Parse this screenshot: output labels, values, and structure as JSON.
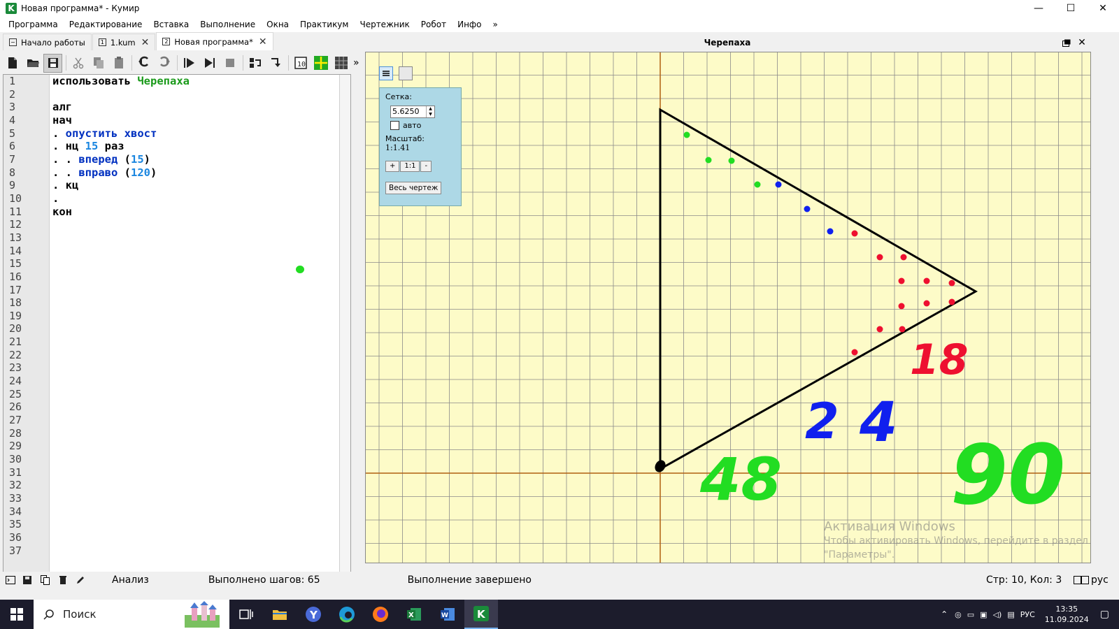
{
  "window": {
    "title": "Новая программа* - Кумир",
    "app_icon_letter": "K",
    "min_label": "—",
    "max_label": "☐",
    "close_label": "✕"
  },
  "menu": [
    "Программа",
    "Редактирование",
    "Вставка",
    "Выполнение",
    "Окна",
    "Практикум",
    "Чертежник",
    "Робот",
    "Инфо",
    "»"
  ],
  "tabs": [
    {
      "label": "Начало работы",
      "icon": "~",
      "close": ""
    },
    {
      "label": "1.kum",
      "icon": "1",
      "close": "✕"
    },
    {
      "label": "Новая программа*",
      "icon": "2",
      "close": "✕"
    }
  ],
  "toolbar_overflow": "»",
  "editor": {
    "line_count": 37,
    "lines": [
      [
        {
          "t": "использовать ",
          "c": "kw"
        },
        {
          "t": "Черепаха",
          "c": "green"
        }
      ],
      [],
      [
        {
          "t": "алг",
          "c": "kw"
        }
      ],
      [
        {
          "t": "нач",
          "c": "kw"
        }
      ],
      [
        {
          "t": ". ",
          "c": "kw"
        },
        {
          "t": "опустить хвост",
          "c": "blue"
        }
      ],
      [
        {
          "t": ". нц ",
          "c": "kw"
        },
        {
          "t": "15",
          "c": "num"
        },
        {
          "t": " раз",
          "c": "kw"
        }
      ],
      [
        {
          "t": ". . ",
          "c": "kw"
        },
        {
          "t": "вперед",
          "c": "blue"
        },
        {
          "t": " (",
          "c": "kw"
        },
        {
          "t": "15",
          "c": "num"
        },
        {
          "t": ")",
          "c": "kw"
        }
      ],
      [
        {
          "t": ". . ",
          "c": "kw"
        },
        {
          "t": "вправо",
          "c": "blue"
        },
        {
          "t": " (",
          "c": "kw"
        },
        {
          "t": "120",
          "c": "num"
        },
        {
          "t": ")",
          "c": "kw"
        }
      ],
      [
        {
          "t": ". кц",
          "c": "kw"
        }
      ],
      [
        {
          "t": ".",
          "c": "kw"
        }
      ],
      [
        {
          "t": "кон",
          "c": "kw"
        }
      ]
    ]
  },
  "turtle_panel": {
    "title": "Черепаха",
    "grid_label": "Сетка:",
    "grid_value": "5.6250",
    "auto_label": "авто",
    "auto_checked": false,
    "scale_label": "Масштаб:",
    "scale_value": "1:1.41",
    "zoom_in": "+",
    "zoom_reset": "1:1",
    "zoom_out": "-",
    "fit_all": "Весь чертеж"
  },
  "handwriting": {
    "red": "18",
    "blue_left": "2",
    "blue_right": "4",
    "green_left": "48",
    "green_right": "90"
  },
  "activation": {
    "title": "Активация Windows",
    "line1": "Чтобы активировать Windows, перейдите в раздел",
    "line2": "\"Параметры\"."
  },
  "status": {
    "analysis": "Анализ",
    "steps": "Выполнено шагов: 65",
    "state": "Выполнение завершено",
    "position": "Стр: 10, Кол: 3",
    "lang": "рус"
  },
  "taskbar": {
    "search_placeholder": "Поиск",
    "lang": "РУС",
    "time": "13:35",
    "date": "11.09.2024"
  },
  "colors": {
    "canvas_bg": "#fdfbc8",
    "grid_line": "#8a8a8a",
    "axis": "#b06010",
    "dot_green": "#22dd22",
    "dot_blue": "#1020ee",
    "dot_red": "#ee1030"
  }
}
